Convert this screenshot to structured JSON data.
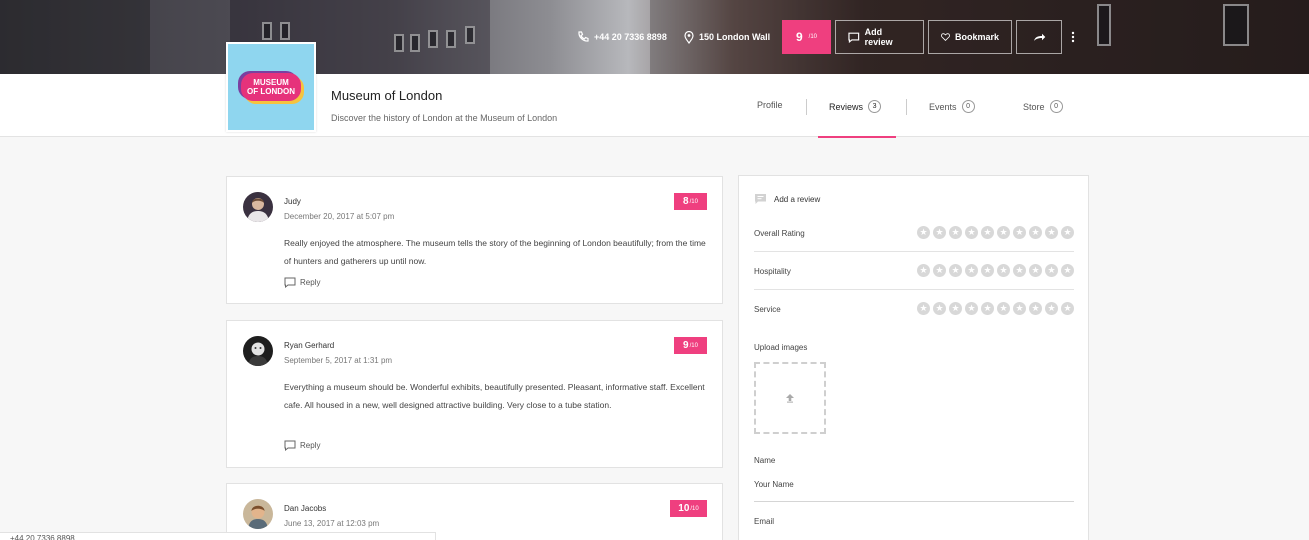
{
  "hero": {
    "phone": "+44 20 7336 8898",
    "address": "150 London Wall",
    "score": "9",
    "score_max": "/10",
    "add_review_label": "Add review",
    "bookmark_label": "Bookmark"
  },
  "company": {
    "logo_line1": "MUSEUM",
    "logo_line2": "OF LONDON",
    "name": "Museum of London",
    "tagline": "Discover the history of London at the Museum of London"
  },
  "tabs": [
    {
      "label": "Profile",
      "count": ""
    },
    {
      "label": "Reviews",
      "count": "3"
    },
    {
      "label": "Events",
      "count": "0"
    },
    {
      "label": "Store",
      "count": "0"
    }
  ],
  "reviews": [
    {
      "name": "Judy",
      "date": "December 20, 2017 at 5:07 pm",
      "score": "8",
      "score_max": "/10",
      "text": "Really enjoyed the atmosphere. The museum tells the story of the beginning of London beautifully; from the time of hunters and gatherers up until now.",
      "reply_label": "Reply"
    },
    {
      "name": "Ryan Gerhard",
      "date": "September 5, 2017 at 1:31 pm",
      "score": "9",
      "score_max": "/10",
      "text": "Everything a museum should be. Wonderful exhibits, beautifully presented. Pleasant, informative staff. Excellent cafe. All housed in a new, well designed attractive building. Very close to a tube station.",
      "reply_label": "Reply"
    },
    {
      "name": "Dan Jacobs",
      "date": "June 13, 2017 at 12:03 pm",
      "score": "10",
      "score_max": "/10"
    }
  ],
  "review_form": {
    "title": "Add a review",
    "criteria": [
      "Overall Rating",
      "Hospitality",
      "Service"
    ],
    "upload_label": "Upload images",
    "name_label": "Name",
    "name_placeholder": "Your Name",
    "email_label": "Email"
  },
  "footer_phone": "+44 20 7336 8898",
  "colors": {
    "accent": "#ef3f7f",
    "logo_bg": "#8fd6ef"
  }
}
